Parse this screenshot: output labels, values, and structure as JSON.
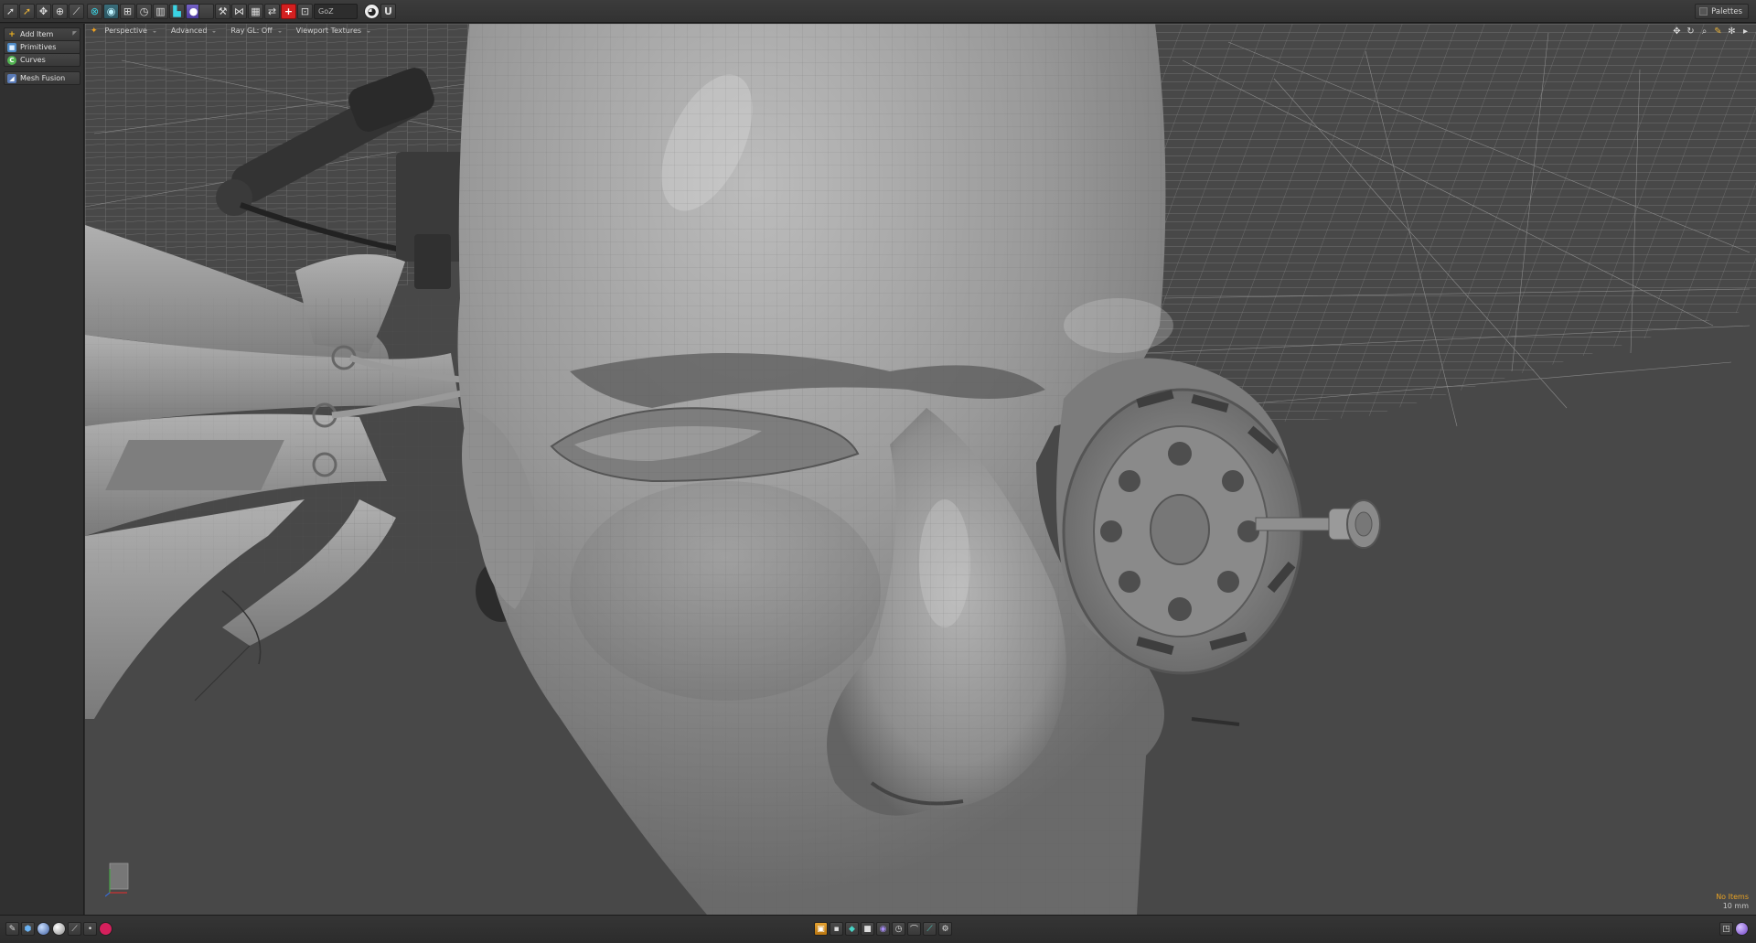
{
  "top_toolbar": {
    "goz_label": "GoZ",
    "palettes_label": "Palettes",
    "icons": [
      "select-arrow-icon",
      "select-arrow-gold-icon",
      "transform-icon",
      "crosshair-icon",
      "knife-icon",
      "snap-icon",
      "workplane-icon",
      "grid-icon",
      "clock-icon",
      "panel-icon",
      "layout-icon",
      "sphere-icon",
      "hammer-icon",
      "mesh-icon",
      "image-icon",
      "link-icon",
      "plus-red-icon",
      "goz-icon",
      "camera-icon",
      "unreal-icon"
    ]
  },
  "left_panel": {
    "items": [
      {
        "label": "Add Item",
        "icon": "plus-icon"
      },
      {
        "label": "Primitives",
        "icon": "cube-icon"
      },
      {
        "label": "Curves",
        "icon": "curve-icon"
      },
      {
        "label": "Mesh Fusion",
        "icon": "fusion-icon"
      }
    ]
  },
  "viewport": {
    "tabs": [
      "Perspective",
      "Advanced",
      "Ray GL: Off",
      "Viewport Textures"
    ],
    "nav_icons": [
      "pan-icon",
      "rotate-icon",
      "zoom-icon",
      "fit-icon",
      "settings-icon",
      "expand-icon"
    ],
    "status": {
      "selection": "No Items",
      "grid": "10 mm"
    }
  },
  "bottom_toolbar": {
    "left_icons": [
      "paint-icon",
      "cube-icon",
      "material-sphere-icon",
      "sphere-icon",
      "brush-icon",
      "dot-icon",
      "record-icon"
    ],
    "center_icons": [
      "item-mode-icon",
      "vertex-mode-icon",
      "edge-mode-icon",
      "polygon-mode-icon",
      "material-mode-icon",
      "timer-icon",
      "curve-icon",
      "snap-icon",
      "gear-icon"
    ],
    "right_icons": [
      "layout-icon",
      "modo-icon"
    ]
  },
  "colors": {
    "accent": "#e8a224",
    "cyan": "#3ad3e4",
    "red": "#d42020",
    "viewport_bg": "#484848"
  }
}
